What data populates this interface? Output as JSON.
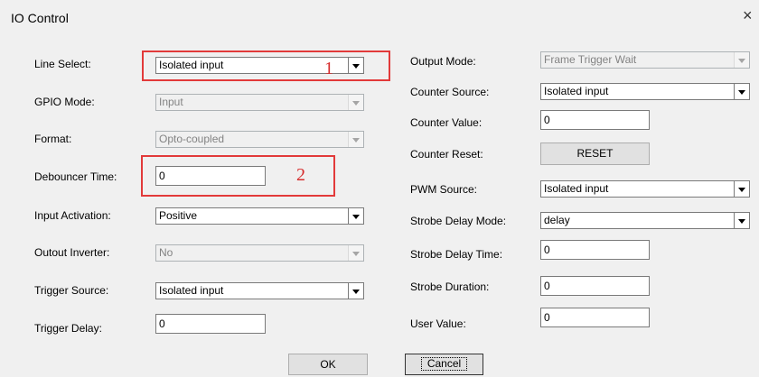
{
  "window": {
    "title": "IO Control",
    "close_glyph": "×"
  },
  "left": {
    "line_select": {
      "label": "Line Select:",
      "value": "Isolated input"
    },
    "gpio_mode": {
      "label": "GPIO Mode:",
      "value": "Input"
    },
    "format": {
      "label": "Format:",
      "value": "Opto-coupled"
    },
    "debouncer_time": {
      "label": "Debouncer Time:",
      "value": "0"
    },
    "input_activation": {
      "label": "Input Activation:",
      "value": "Positive"
    },
    "output_inverter": {
      "label": "Outout Inverter:",
      "value": "No"
    },
    "trigger_source": {
      "label": "Trigger Source:",
      "value": "Isolated input"
    },
    "trigger_delay": {
      "label": "Trigger Delay:",
      "value": "0"
    }
  },
  "right": {
    "output_mode": {
      "label": "Output Mode:",
      "value": "Frame Trigger Wait"
    },
    "counter_source": {
      "label": "Counter Source:",
      "value": "Isolated input"
    },
    "counter_value": {
      "label": "Counter Value:",
      "value": "0"
    },
    "counter_reset": {
      "label": "Counter Reset:",
      "button": "RESET"
    },
    "pwm_source": {
      "label": "PWM Source:",
      "value": "Isolated input"
    },
    "strobe_delay_mode": {
      "label": "Strobe Delay Mode:",
      "value": "delay"
    },
    "strobe_delay_time": {
      "label": "Strobe Delay Time:",
      "value": "0"
    },
    "strobe_duration": {
      "label": "Strobe Duration:",
      "value": "0"
    },
    "user_value": {
      "label": "User Value:",
      "value": "0"
    }
  },
  "buttons": {
    "ok": "OK",
    "cancel": "Cancel"
  },
  "annotations": {
    "marker_1": "1",
    "marker_2": "2",
    "color": "#e23a3a"
  },
  "icons": {
    "dropdown": "chevron-down-icon",
    "close": "close-icon"
  }
}
